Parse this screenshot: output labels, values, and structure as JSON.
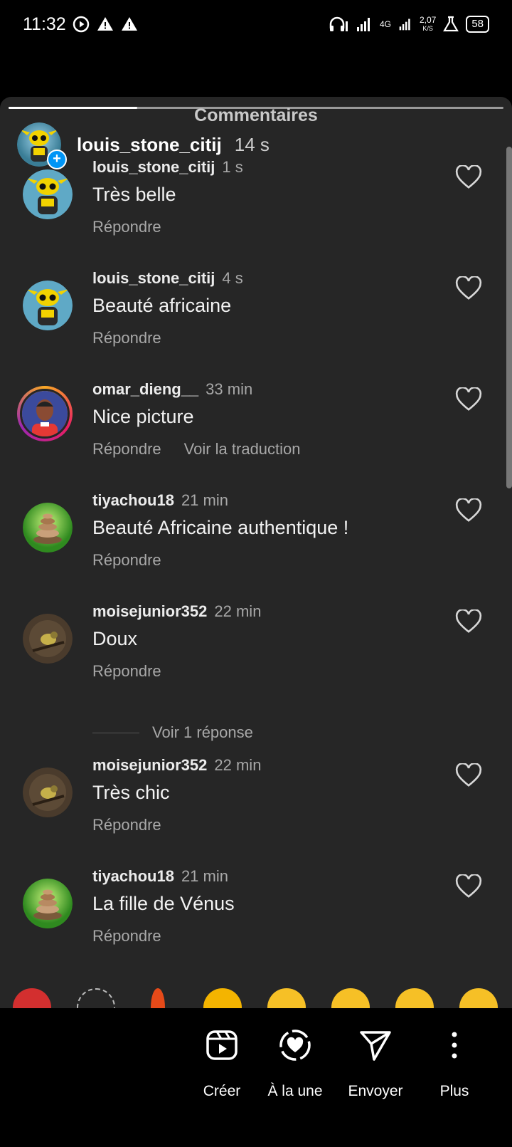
{
  "status_bar": {
    "time": "11:32",
    "net_type": "4G",
    "speed_value": "2,07",
    "speed_unit": "K/S",
    "battery": "58"
  },
  "sheet": {
    "title": "Commentaires",
    "progress_fraction": 0.26,
    "story_user": "louis_stone_citij",
    "story_time": "14 s"
  },
  "comments": [
    {
      "user": "louis_stone_citij",
      "time": "1 s",
      "text": "Très belle",
      "reply": "Répondre",
      "translate": ""
    },
    {
      "user": "louis_stone_citij",
      "time": "4 s",
      "text": "Beauté africaine",
      "reply": "Répondre",
      "translate": ""
    },
    {
      "user": "omar_dieng__",
      "time": "33 min",
      "text": "Nice picture",
      "reply": "Répondre",
      "translate": "Voir la traduction"
    },
    {
      "user": "tiyachou18",
      "time": "21 min",
      "text": "Beauté Africaine authentique !",
      "reply": "Répondre",
      "translate": ""
    },
    {
      "user": "moisejunior352",
      "time": "22 min",
      "text": "Doux",
      "reply": "Répondre",
      "translate": ""
    },
    {
      "user": "moisejunior352",
      "time": "22 min",
      "text": "Très chic",
      "reply": "Répondre",
      "translate": ""
    },
    {
      "user": "tiyachou18",
      "time": "21 min",
      "text": "La fille de Vénus",
      "reply": "Répondre",
      "translate": ""
    }
  ],
  "view_replies": "Voir 1 réponse",
  "bottom_bar": {
    "create": "Créer",
    "featured": "À la une",
    "send": "Envoyer",
    "more": "Plus"
  },
  "colors": {
    "sheet_bg": "#262626",
    "accent_blue": "#0095f6",
    "muted_text": "#a8a8a8"
  }
}
